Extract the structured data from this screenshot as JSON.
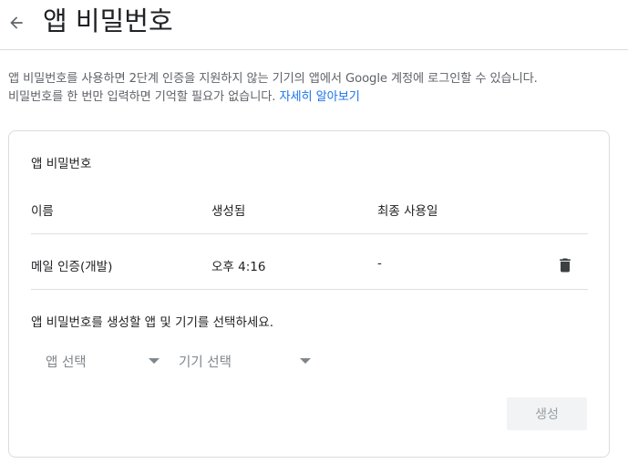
{
  "header": {
    "back_icon": "arrow-back-icon",
    "title": "앱 비밀번호"
  },
  "description": {
    "line1": "앱 비밀번호를 사용하면 2단계 인증을 지원하지 않는 기기의 앱에서 Google 계정에 로그인할 수 있습니다.",
    "line2_text": "비밀번호를 한 번만 입력하면 기억할 필요가 없습니다.",
    "learn_more": "자세히 알아보기"
  },
  "card": {
    "title": "앱 비밀번호",
    "columns": {
      "name": "이름",
      "created": "생성됨",
      "last_used": "최종 사용일"
    },
    "rows": [
      {
        "name": "메일 인증(개발)",
        "created": "오후 4:16",
        "last_used": "-",
        "action_icon": "trash-icon"
      }
    ],
    "instruction": "앱 비밀번호를 생성할 앱 및 기기를 선택하세요.",
    "app_select": {
      "placeholder": "앱 선택",
      "icon": "dropdown-caret-icon"
    },
    "device_select": {
      "placeholder": "기기 선택",
      "icon": "dropdown-caret-icon"
    },
    "generate_button": "생성"
  },
  "colors": {
    "link": "#1a73e8",
    "text": "#202124",
    "secondary_text": "#5f6368",
    "border": "#dadce0",
    "disabled_button_bg": "#f1f3f4",
    "disabled_button_text": "#9aa0a6"
  }
}
